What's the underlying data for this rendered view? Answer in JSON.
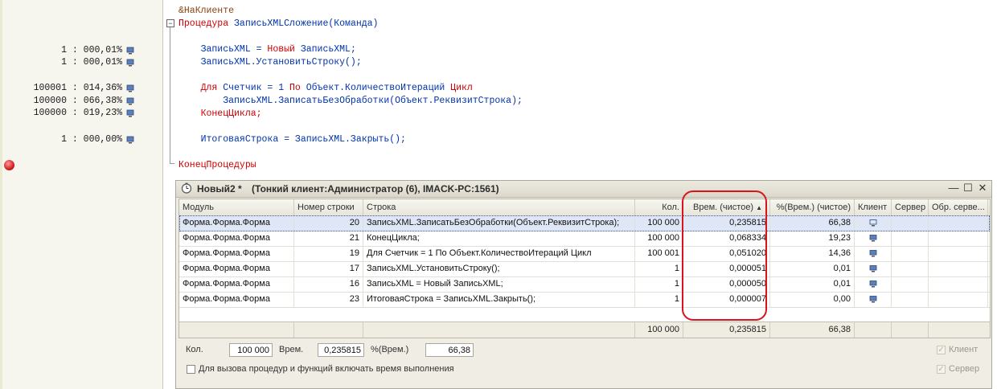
{
  "gutter": {
    "perf_lines": [
      {
        "text": "1 : 000,01%"
      },
      {
        "text": "1 : 000,01%"
      },
      {
        "text": "100001 : 014,36%"
      },
      {
        "text": "100000 : 066,38%"
      },
      {
        "text": "100000 : 019,23%"
      },
      {
        "text": "1 : 000,00%"
      }
    ]
  },
  "code": {
    "directive": "&НаКлиенте",
    "proc_kw": "Процедура",
    "proc_name": " ЗаписьXMLСложение(Команда)",
    "l1_a": "    ЗаписьXML = ",
    "l1_kw": "Новый",
    "l1_b": " ЗаписьXML;",
    "l2": "    ЗаписьXML.УстановитьСтроку();",
    "l3_kw1": "    Для",
    "l3_a": " Счетчик = 1 ",
    "l3_kw2": "По",
    "l3_b": " Объект.КоличествоИтераций ",
    "l3_kw3": "Цикл",
    "l4": "        ЗаписьXML.ЗаписатьБезОбработки(Объект.РеквизитСтрока);",
    "l5_kw": "    КонецЦикла;",
    "l6": "    ИтоговаяСтрока = ЗаписьXML.Закрыть();",
    "end_kw": "КонецПроцедуры"
  },
  "window": {
    "title": "Новый2 *",
    "subtitle": "(Тонкий клиент:Администратор (6), IMACK-PC:1561)",
    "ctrl_min": "—",
    "ctrl_max": "☐",
    "ctrl_close": "✕"
  },
  "table": {
    "columns": [
      "Модуль",
      "Номер строки",
      "Строка",
      "Кол.",
      "Врем. (чистое)",
      "%(Врем.) (чистое)",
      "Клиент",
      "Сервер",
      "Обр. серве..."
    ],
    "sort_indicator": "▲",
    "rows": [
      {
        "module": "Форма.Форма.Форма",
        "line": "20",
        "text": "ЗаписьXML.ЗаписатьБезОбработки(Объект.РеквизитСтрока);",
        "count": "100 000",
        "time": "0,235815",
        "pct": "66,38"
      },
      {
        "module": "Форма.Форма.Форма",
        "line": "21",
        "text": "КонецЦикла;",
        "count": "100 000",
        "time": "0,068334",
        "pct": "19,23"
      },
      {
        "module": "Форма.Форма.Форма",
        "line": "19",
        "text": "Для Счетчик = 1 По Объект.КоличествоИтераций Цикл",
        "count": "100 001",
        "time": "0,051020",
        "pct": "14,36"
      },
      {
        "module": "Форма.Форма.Форма",
        "line": "17",
        "text": "ЗаписьXML.УстановитьСтроку();",
        "count": "1",
        "time": "0,000051",
        "pct": "0,01"
      },
      {
        "module": "Форма.Форма.Форма",
        "line": "16",
        "text": "ЗаписьXML = Новый ЗаписьXML;",
        "count": "1",
        "time": "0,000050",
        "pct": "0,01"
      },
      {
        "module": "Форма.Форма.Форма",
        "line": "23",
        "text": "ИтоговаяСтрока = ЗаписьXML.Закрыть();",
        "count": "1",
        "time": "0,000007",
        "pct": "0,00"
      }
    ],
    "totals": {
      "count": "100 000",
      "time": "0,235815",
      "pct": "66,38"
    }
  },
  "summary": {
    "count_label": "Кол.",
    "count_value": "100 000",
    "time_label": "Врем.",
    "time_value": "0,235815",
    "pct_label": "%(Врем.)",
    "pct_value": "66,38",
    "include_time_label": "Для вызова процедур и функций включать время выполнения",
    "client_label": "Клиент",
    "server_label": "Сервер",
    "check_mark": "✓"
  },
  "colors": {
    "highlight": "#d8141c",
    "selection": "#dfe7f6",
    "keyword": "#d00000",
    "identifier": "#0033aa"
  }
}
